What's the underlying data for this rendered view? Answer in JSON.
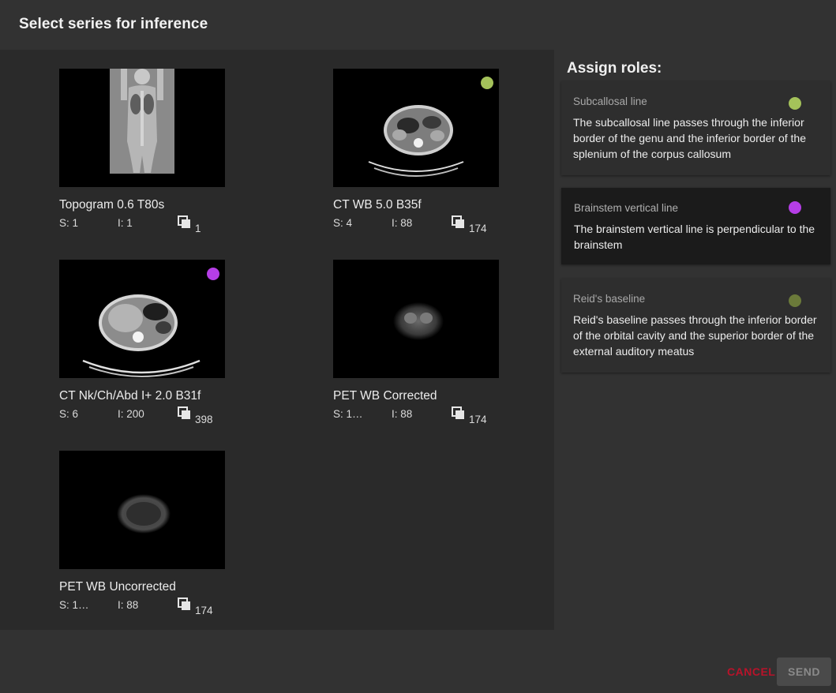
{
  "dialog": {
    "title": "Select series for inference"
  },
  "series": [
    {
      "name": "Topogram 0.6 T80s",
      "s": "S: 1",
      "i": "I: 1",
      "count": "1",
      "role_color": ""
    },
    {
      "name": "CT WB 5.0 B35f",
      "s": "S: 4",
      "i": "I: 88",
      "count": "174",
      "role_color": "#a4c25a"
    },
    {
      "name": "CT Nk/Ch/Abd I+ 2.0 B31f",
      "s": "S: 6",
      "i": "I: 200",
      "count": "398",
      "role_color": "#b53ee6"
    },
    {
      "name": "PET WB Corrected",
      "s": "S: 1…",
      "i": "I: 88",
      "count": "174",
      "role_color": ""
    },
    {
      "name": "PET WB Uncorrected",
      "s": "S: 1…",
      "i": "I: 88",
      "count": "174",
      "role_color": ""
    }
  ],
  "roles": {
    "title": "Assign roles:",
    "items": [
      {
        "name": "Subcallosal line",
        "description": "The subcallosal line passes through the inferior border of the genu and the inferior border of the splenium of the corpus callosum",
        "color": "#a4c25a",
        "selected": false
      },
      {
        "name": "Brainstem vertical line",
        "description": "The brainstem vertical line is perpendicular to the brainstem",
        "color": "#b53ee6",
        "selected": true
      },
      {
        "name": "Reid's baseline",
        "description": "Reid's baseline passes through the inferior border of the orbital cavity and the superior border of the external auditory meatus",
        "color": "#6b7a3a",
        "selected": false
      }
    ]
  },
  "footer": {
    "cancel_label": "CANCEL",
    "send_label": "SEND"
  }
}
